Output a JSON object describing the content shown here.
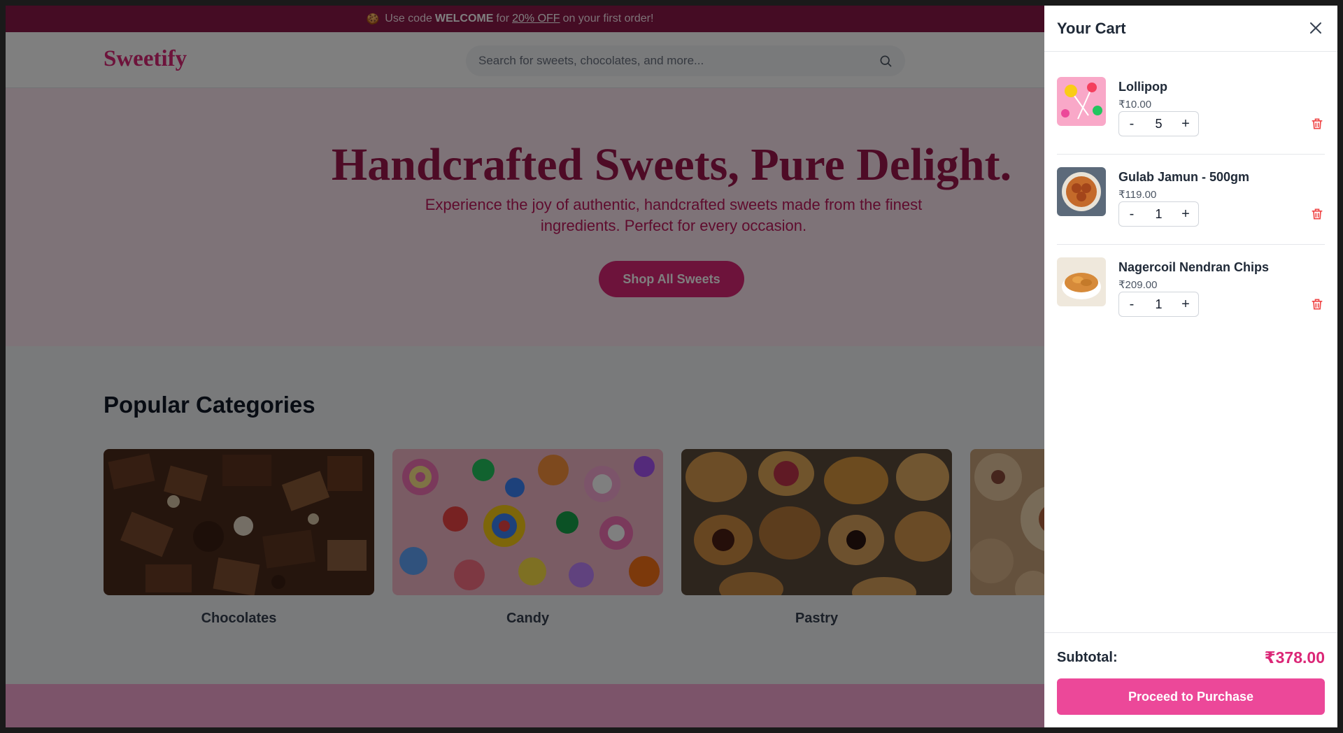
{
  "promo": {
    "emoji": "🍪",
    "prefix": "Use code",
    "code": "WELCOME",
    "middle": "for",
    "discount": "20% OFF",
    "suffix": "on your first order!"
  },
  "header": {
    "logo": "Sweetify",
    "search_placeholder": "Search for sweets, chocolates, and more..."
  },
  "hero": {
    "title": "Handcrafted Sweets, Pure Delight.",
    "subtitle": "Experience the joy of authentic, handcrafted sweets made from the finest ingredients. Perfect for every occasion.",
    "cta": "Shop All Sweets"
  },
  "categories": {
    "heading": "Popular Categories",
    "items": [
      {
        "label": "Chocolates"
      },
      {
        "label": "Candy"
      },
      {
        "label": "Pastry"
      },
      {
        "label": ""
      }
    ]
  },
  "cart": {
    "title": "Your Cart",
    "items": [
      {
        "name": "Lollipop",
        "price": "₹10.00",
        "qty": "5"
      },
      {
        "name": "Gulab Jamun - 500gm",
        "price": "₹119.00",
        "qty": "1"
      },
      {
        "name": "Nagercoil Nendran Chips",
        "price": "₹209.00",
        "qty": "1"
      }
    ],
    "minus": "-",
    "plus": "+",
    "subtotal_label": "Subtotal:",
    "subtotal_value": "₹378.00",
    "checkout": "Proceed to Purchase"
  },
  "colors": {
    "brand": "#db2777",
    "promo_bg": "#8a1848",
    "hero_bg": "#fce7f1",
    "checkout_bg": "#ec4899",
    "delete": "#ef4444"
  }
}
